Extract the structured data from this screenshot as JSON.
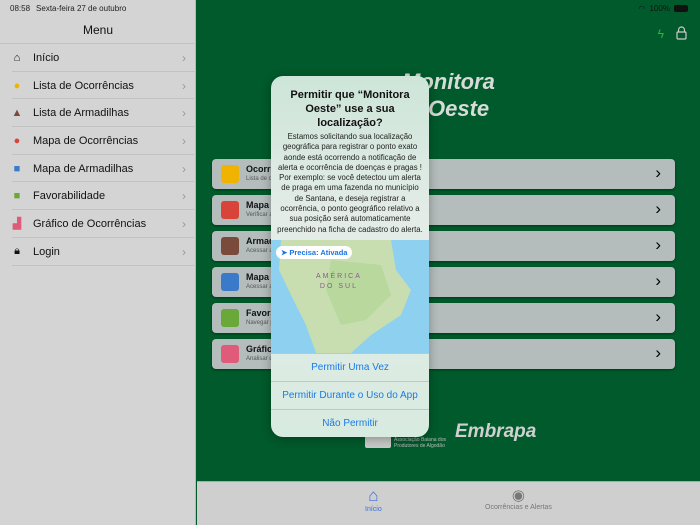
{
  "status": {
    "time": "08:58",
    "date": "Sexta-feira 27 de outubro",
    "battery": "100%"
  },
  "sidebar": {
    "title": "Menu",
    "items": [
      {
        "label": "Início",
        "icon": "home-icon"
      },
      {
        "label": "Lista de Ocorrências",
        "icon": "bell-icon"
      },
      {
        "label": "Lista de Armadilhas",
        "icon": "trap-icon"
      },
      {
        "label": "Mapa de Ocorrências",
        "icon": "map-pin-icon"
      },
      {
        "label": "Mapa de Armadilhas",
        "icon": "map-icon"
      },
      {
        "label": "Favorabilidade",
        "icon": "field-map-icon"
      },
      {
        "label": "Gráfico de Ocorrências",
        "icon": "chart-icon"
      },
      {
        "label": "Login",
        "icon": "lock-icon"
      }
    ]
  },
  "main": {
    "logo_line1": "Monitora",
    "logo_line2": "Oeste",
    "cards": [
      {
        "title": "Ocorrê",
        "subtitle": "Lista de o",
        "color": "#f0b400"
      },
      {
        "title": "Mapa d",
        "subtitle": "Verificar a",
        "color": "#d9443a"
      },
      {
        "title": "Armad",
        "subtitle": "Acessar a",
        "color": "#7a4a3a"
      },
      {
        "title": "Mapa d",
        "subtitle": "Acessar a",
        "color": "#3a7ac8"
      },
      {
        "title": "Favora",
        "subtitle": "Navegar p",
        "color": "#6aa83a"
      },
      {
        "title": "Gráfico",
        "subtitle": "Analisar d",
        "color": "#e05a7a"
      }
    ],
    "partner_text": "Associação Baiana dos Produtores de Algodão",
    "partner_name": "pa",
    "embrapa": "Embrapa"
  },
  "tabbar": {
    "tabs": [
      {
        "label": "Início",
        "active": true
      },
      {
        "label": "Ocorrências e Alertas",
        "active": false
      }
    ]
  },
  "dialog": {
    "title": "Permitir que “Monitora Oeste” use a sua localização?",
    "body": "Estamos solicitando sua localização geográfica para registrar o ponto exato aonde está ocorrendo a notificação de alerta e ocorrência de doenças e pragas ! Por exemplo: se você detectou um alerta de praga em uma fazenda no município de Santana, e deseja registrar a ocorrência, o ponto geográfico relativo a sua posição será automaticamente preenchido na ficha de cadastro do alerta.",
    "precise": "Precisa: Ativada",
    "map_label_1": "AMÉRICA",
    "map_label_2": "DO SUL",
    "buttons": [
      "Permitir Uma Vez",
      "Permitir Durante o Uso do App",
      "Não Permitir"
    ]
  }
}
